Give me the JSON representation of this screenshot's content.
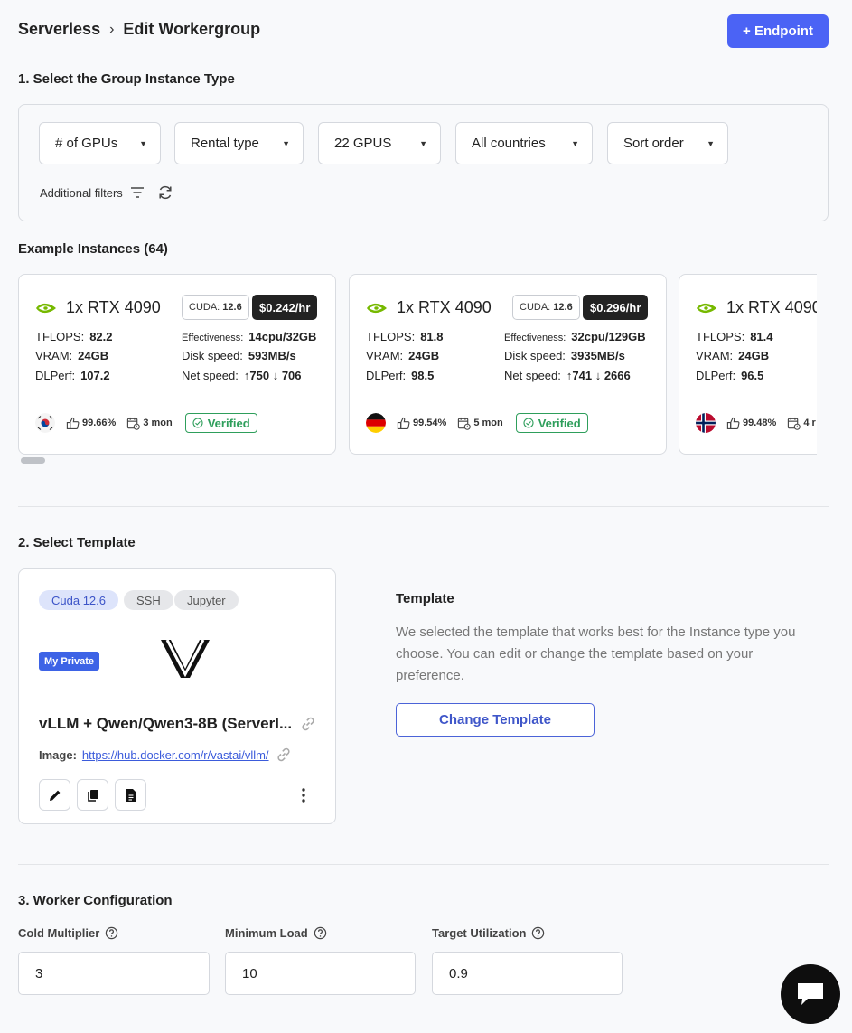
{
  "header": {
    "breadcrumb_root": "Serverless",
    "breadcrumb_current": "Edit Workergroup",
    "endpoint_button": "+ Endpoint"
  },
  "section1": {
    "title": "1. Select the Group Instance Type",
    "filters": [
      {
        "label": "# of GPUs"
      },
      {
        "label": "Rental type"
      },
      {
        "label": "22 GPUS"
      },
      {
        "label": "All countries"
      },
      {
        "label": "Sort order"
      }
    ],
    "additional_filters": "Additional filters",
    "examples_title": "Example Instances (64)"
  },
  "instances": [
    {
      "gpu": "1x RTX 4090",
      "cuda": "CUDA:",
      "cuda_ver": "12.6",
      "price": "$0.242/hr",
      "tflops": "82.2",
      "vram": "24GB",
      "dlperf": "107.2",
      "effectiveness": "14cpu/32GB",
      "disk_speed": "593MB/s",
      "net_up": "750",
      "net_down": "706",
      "reliability": "99.66%",
      "duration": "3 mon",
      "verified": "Verified",
      "country": "KR"
    },
    {
      "gpu": "1x RTX 4090",
      "cuda": "CUDA:",
      "cuda_ver": "12.6",
      "price": "$0.296/hr",
      "tflops": "81.8",
      "vram": "24GB",
      "dlperf": "98.5",
      "effectiveness": "32cpu/129GB",
      "disk_speed": "3935MB/s",
      "net_up": "741",
      "net_down": "2666",
      "reliability": "99.54%",
      "duration": "5 mon",
      "verified": "Verified",
      "country": "DE"
    },
    {
      "gpu": "1x RTX 4090",
      "tflops": "81.4",
      "vram": "24GB",
      "dlperf": "96.5",
      "reliability": "99.48%",
      "duration": "4 r",
      "country": "NO"
    }
  ],
  "spec_labels": {
    "tflops": "TFLOPS:",
    "vram": "VRAM:",
    "dlperf": "DLPerf:",
    "effectiveness": "Effectiveness:",
    "disk_speed": "Disk speed:",
    "net_speed": "Net speed:"
  },
  "section2": {
    "title": "2. Select Template",
    "chips": [
      "Cuda 12.6",
      "SSH",
      "Jupyter"
    ],
    "private_badge": "My Private",
    "template_name": "vLLM + Qwen/Qwen3-8B (Serverl...",
    "image_label": "Image:",
    "image_url": "https://hub.docker.com/r/vastai/vllm/",
    "info_title": "Template",
    "info_text": "We selected the template that works best for the Instance type you choose. You can edit or change the template based on your preference.",
    "change_button": "Change Template"
  },
  "section3": {
    "title": "3. Worker Configuration",
    "fields": [
      {
        "label": "Cold Multiplier",
        "value": "3"
      },
      {
        "label": "Minimum Load",
        "value": "10"
      },
      {
        "label": "Target Utilization",
        "value": "0.9"
      }
    ]
  },
  "colors": {
    "accent": "#4b63f5",
    "verified": "#2e9e5b",
    "nvidia": "#76b900"
  }
}
